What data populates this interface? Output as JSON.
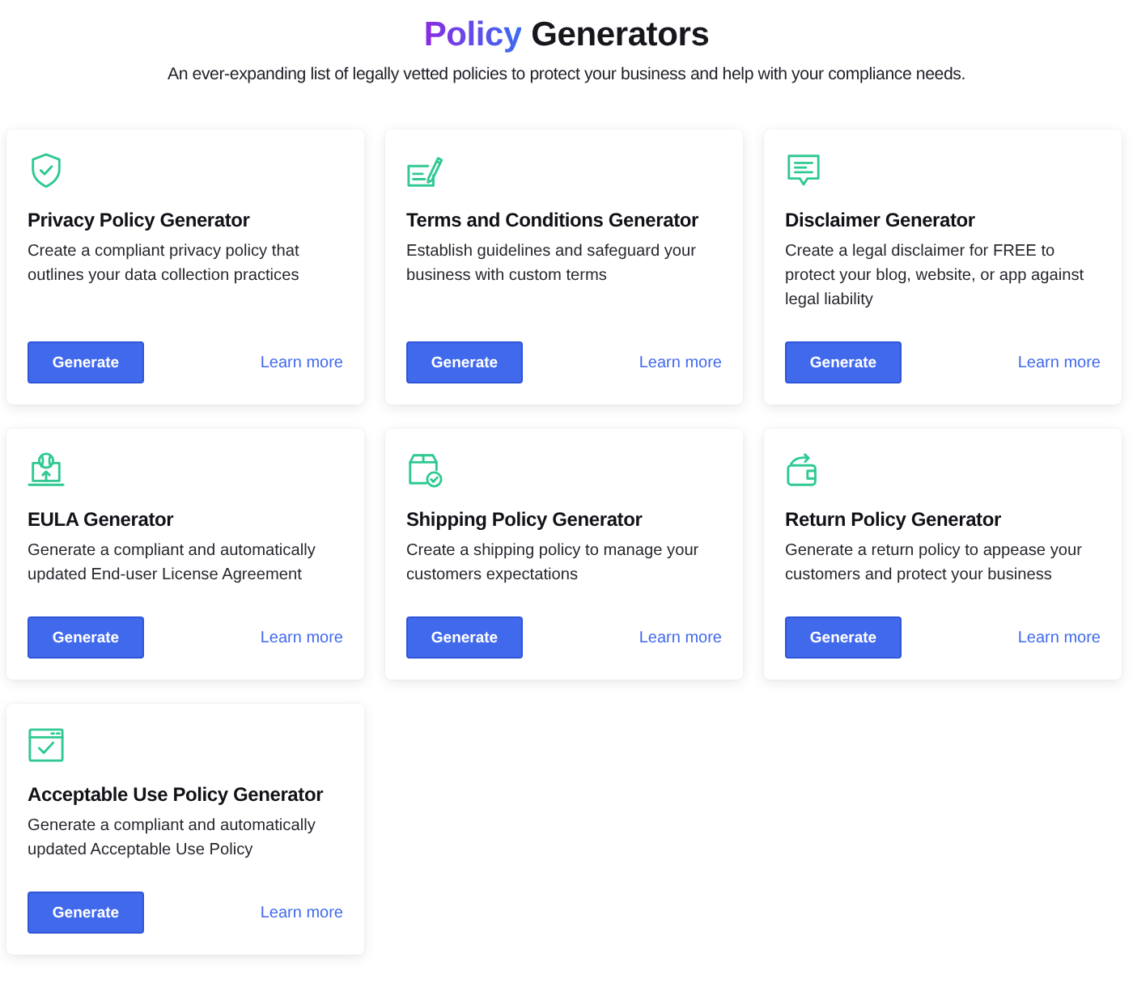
{
  "header": {
    "title_highlight": "Policy",
    "title": "Generators",
    "subtitle": "An ever-expanding list of legally vetted policies to protect your business and help with your compliance needs."
  },
  "cards": [
    {
      "title": "Privacy Policy Generator",
      "description": "Create a compliant privacy policy that outlines your data collection practices",
      "button": "Generate",
      "link": "Learn more"
    },
    {
      "title": "Terms and Conditions Generator",
      "description": "Establish guidelines and safeguard your business with custom terms",
      "button": "Generate",
      "link": "Learn more"
    },
    {
      "title": "Disclaimer Generator",
      "description": "Create a legal disclaimer for FREE to protect your blog, website, or app against legal liability",
      "button": "Generate",
      "link": "Learn more"
    },
    {
      "title": "EULA Generator",
      "description": "Generate a compliant and automatically updated End-user License Agreement",
      "button": "Generate",
      "link": "Learn more"
    },
    {
      "title": "Shipping Policy Generator",
      "description": "Create a shipping policy to manage your customers expectations",
      "button": "Generate",
      "link": "Learn more"
    },
    {
      "title": "Return Policy Generator",
      "description": "Generate a return policy to appease your customers and protect your business",
      "button": "Generate",
      "link": "Learn more"
    },
    {
      "title": "Acceptable Use Policy Generator",
      "description": "Generate a compliant and automatically updated Acceptable Use Policy",
      "button": "Generate",
      "link": "Learn more"
    }
  ]
}
